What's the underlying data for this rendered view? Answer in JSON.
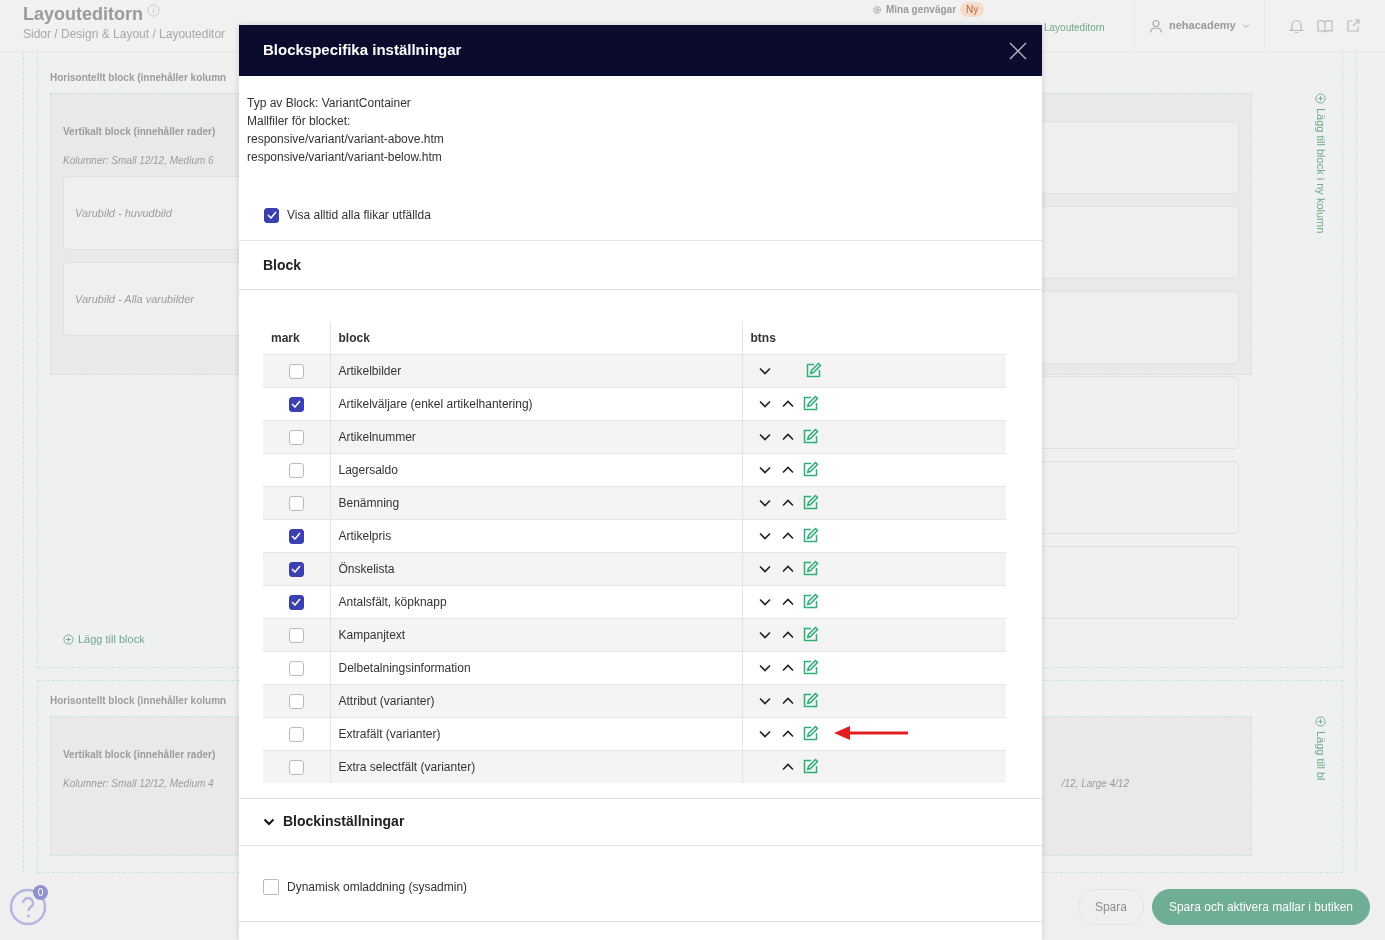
{
  "page": {
    "title": "Layouteditorn",
    "breadcrumb": "Sidor / Design & Layout / Layouteditor",
    "shortcuts_label": "Mina genvägar",
    "shortcuts_badge": "Ny",
    "shortcut_link": "Layouteditorn",
    "user": "nehacademy",
    "help_count": "0"
  },
  "canvas": {
    "blocks": [
      {
        "title": "Horisontellt block (innehåller kolumn",
        "column_title": "Vertikalt block (innehåller rader)",
        "columns_info": "Kolumner: Small 12/12, Medium 6",
        "items": [
          "Varubild - huvudbild",
          "Varubild - Alla varubilder"
        ],
        "add_label": "Lägg till block",
        "side_add": "Lägg till block i ny kolumn"
      },
      {
        "title": "Horisontellt block (innehåller kolumn",
        "column_title": "Vertikalt block (innehåller rader)",
        "columns_info": "Kolumner: Small 12/12, Medium 4",
        "right_info": "/12, Large 4/12",
        "side_add": "Lägg till bl"
      }
    ]
  },
  "footer": {
    "buttons": [
      {
        "label": "Spara",
        "kind": "secondary"
      },
      {
        "label": "Spara och aktivera mallar i butiken",
        "kind": "primary"
      }
    ]
  },
  "modal": {
    "title": "Blockspecifika inställningar",
    "info": [
      "Typ av Block: VariantContainer",
      "Mallfiler för blocket:",
      "responsive/variant/variant-above.htm",
      "responsive/variant/variant-below.htm"
    ],
    "expand_all": {
      "label": "Visa alltid alla flikar utfällda",
      "checked": true
    },
    "block_section": "Block",
    "table": {
      "columns": [
        "mark",
        "block",
        "btns"
      ],
      "rows": [
        {
          "checked": false,
          "name": "Artikelbilder",
          "down": true,
          "up": false,
          "annotated": false
        },
        {
          "checked": true,
          "name": "Artikelväljare (enkel artikelhantering)",
          "down": true,
          "up": true,
          "annotated": false
        },
        {
          "checked": false,
          "name": "Artikelnummer",
          "down": true,
          "up": true,
          "annotated": false
        },
        {
          "checked": false,
          "name": "Lagersaldo",
          "down": true,
          "up": true,
          "annotated": false
        },
        {
          "checked": false,
          "name": "Benämning",
          "down": true,
          "up": true,
          "annotated": false
        },
        {
          "checked": true,
          "name": "Artikelpris",
          "down": true,
          "up": true,
          "annotated": false
        },
        {
          "checked": true,
          "name": "Önskelista",
          "down": true,
          "up": true,
          "annotated": false
        },
        {
          "checked": true,
          "name": "Antalsfält, köpknapp",
          "down": true,
          "up": true,
          "annotated": false
        },
        {
          "checked": false,
          "name": "Kampanjtext",
          "down": true,
          "up": true,
          "annotated": false
        },
        {
          "checked": false,
          "name": "Delbetalningsinformation",
          "down": true,
          "up": true,
          "annotated": false
        },
        {
          "checked": false,
          "name": "Attribut (varianter)",
          "down": true,
          "up": true,
          "annotated": false
        },
        {
          "checked": false,
          "name": "Extrafält (varianter)",
          "down": true,
          "up": true,
          "annotated": true
        },
        {
          "checked": false,
          "name": "Extra selectfält (varianter)",
          "down": false,
          "up": true,
          "annotated": false
        }
      ]
    },
    "settings": {
      "title": "Blockinställningar",
      "expanded": true,
      "options": [
        {
          "label": "Dynamisk omladdning (sysadmin)",
          "checked": false
        }
      ]
    }
  }
}
